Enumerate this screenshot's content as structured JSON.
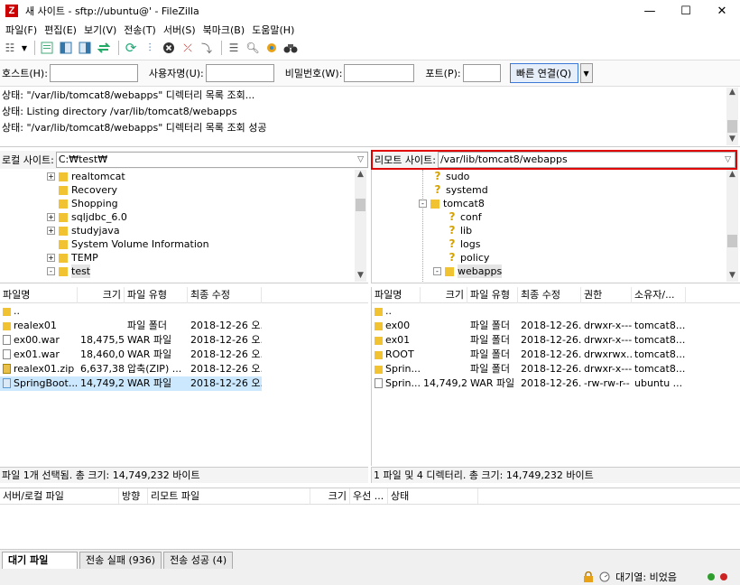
{
  "window": {
    "title": "새 사이트 - sftp://ubuntu@'                     - FileZilla",
    "icon": "filezilla-icon",
    "controls": {
      "minimize": "—",
      "maximize": "☐",
      "close": "✕"
    }
  },
  "menu": [
    "파일(F)",
    "편집(E)",
    "보기(V)",
    "전송(T)",
    "서버(S)",
    "북마크(B)",
    "도움말(H)"
  ],
  "quickconnect": {
    "host_label": "호스트(H):",
    "user_label": "사용자명(U):",
    "pass_label": "비밀번호(W):",
    "port_label": "포트(P):",
    "connect_button": "빠른 연결(Q)"
  },
  "log": [
    "상태:  \"/var/lib/tomcat8/webapps\" 디렉터리 목록 조회...",
    "상태:  Listing directory /var/lib/tomcat8/webapps",
    "상태:  \"/var/lib/tomcat8/webapps\" 디렉터리 목록 조회 성공"
  ],
  "local": {
    "site_label": "로컬 사이트:",
    "path": "C:₩test₩",
    "tree": [
      {
        "name": "realtomcat",
        "expand": "+"
      },
      {
        "name": "Recovery",
        "expand": ""
      },
      {
        "name": "Shopping",
        "expand": ""
      },
      {
        "name": "sqljdbc_6.0",
        "expand": "+"
      },
      {
        "name": "studyjava",
        "expand": "+"
      },
      {
        "name": "System Volume Information",
        "expand": ""
      },
      {
        "name": "TEMP",
        "expand": "+"
      },
      {
        "name": "test",
        "expand": "-"
      }
    ],
    "columns": [
      "파일명",
      "크기",
      "파일 유형",
      "최종 수정"
    ],
    "files": [
      {
        "name": "..",
        "size": "",
        "type": "",
        "modified": "",
        "icon": "folder"
      },
      {
        "name": "realex01",
        "size": "",
        "type": "파일 폴더",
        "modified": "2018-12-26 오...",
        "icon": "folder"
      },
      {
        "name": "ex00.war",
        "size": "18,475,5...",
        "type": "WAR 파일",
        "modified": "2018-12-26 오...",
        "icon": "file"
      },
      {
        "name": "ex01.war",
        "size": "18,460,0...",
        "type": "WAR 파일",
        "modified": "2018-12-26 오...",
        "icon": "file"
      },
      {
        "name": "realex01.zip",
        "size": "6,637,383",
        "type": "압축(ZIP) ...",
        "modified": "2018-12-26 오...",
        "icon": "zip"
      },
      {
        "name": "SpringBoot...",
        "size": "14,749,2...",
        "type": "WAR 파일",
        "modified": "2018-12-26 오...",
        "icon": "file",
        "selected": true
      }
    ],
    "status": "파일 1개 선택됨. 총 크기: 14,749,232 바이트"
  },
  "remote": {
    "site_label": "리모트 사이트:",
    "path": "/var/lib/tomcat8/webapps",
    "tree": [
      {
        "name": "sudo",
        "kind": "unknown",
        "indent": 1,
        "expand": ""
      },
      {
        "name": "systemd",
        "kind": "unknown",
        "indent": 1,
        "expand": ""
      },
      {
        "name": "tomcat8",
        "kind": "folder",
        "indent": 1,
        "expand": "-"
      },
      {
        "name": "conf",
        "kind": "unknown",
        "indent": 2,
        "expand": ""
      },
      {
        "name": "lib",
        "kind": "unknown",
        "indent": 2,
        "expand": ""
      },
      {
        "name": "logs",
        "kind": "unknown",
        "indent": 2,
        "expand": ""
      },
      {
        "name": "policy",
        "kind": "unknown",
        "indent": 2,
        "expand": ""
      },
      {
        "name": "webapps",
        "kind": "folder",
        "indent": 2,
        "expand": "-"
      }
    ],
    "columns": [
      "파일명",
      "크기",
      "파일 유형",
      "최종 수정",
      "권한",
      "소유자/..."
    ],
    "files": [
      {
        "name": "..",
        "size": "",
        "type": "",
        "modified": "",
        "perm": "",
        "owner": "",
        "icon": "folder"
      },
      {
        "name": "ex00",
        "size": "",
        "type": "파일 폴더",
        "modified": "2018-12-26...",
        "perm": "drwxr-x---",
        "owner": "tomcat8...",
        "icon": "folder"
      },
      {
        "name": "ex01",
        "size": "",
        "type": "파일 폴더",
        "modified": "2018-12-26...",
        "perm": "drwxr-x---",
        "owner": "tomcat8...",
        "icon": "folder"
      },
      {
        "name": "ROOT",
        "size": "",
        "type": "파일 폴더",
        "modified": "2018-12-26...",
        "perm": "drwxrwx...",
        "owner": "tomcat8...",
        "icon": "folder"
      },
      {
        "name": "Sprin...",
        "size": "",
        "type": "파일 폴더",
        "modified": "2018-12-26...",
        "perm": "drwxr-x---",
        "owner": "tomcat8...",
        "icon": "folder"
      },
      {
        "name": "Sprin...",
        "size": "14,749,2...",
        "type": "WAR 파일",
        "modified": "2018-12-26...",
        "perm": "-rw-rw-r--",
        "owner": "ubuntu ...",
        "icon": "file"
      }
    ],
    "status": "1 파일 및 4 디렉터리. 총 크기: 14,749,232 바이트"
  },
  "queue": {
    "columns": [
      "서버/로컬 파일",
      "방향",
      "리모트 파일",
      "크기",
      "우선 ...",
      "상태"
    ]
  },
  "tabs": [
    "대기 파일",
    "전송 실패 (936)",
    "전송 성공 (4)"
  ],
  "statusbar": {
    "queue_text": "대기열: 비었음"
  },
  "colors": {
    "highlight_border": "#e00000",
    "folder": "#f1c232",
    "selection": "#cce8ff",
    "led_green": "#2e9e2e",
    "led_red": "#cc2222"
  }
}
